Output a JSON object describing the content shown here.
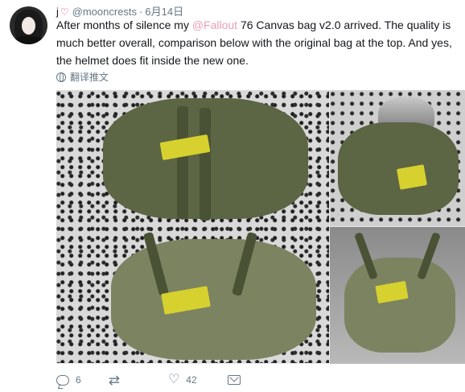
{
  "tweet": {
    "display_name": "j",
    "handle": "@mooncrests",
    "separator": "·",
    "time": "6月14日",
    "text_before": "After months of silence my ",
    "mention": "@Fallout",
    "text_after": " 76 Canvas bag v2.0 arrived. The quality is much better overall, comparison below with the original bag at the top. And yes, the helmet does fit inside the new one.",
    "translate_label": "翻译推文"
  },
  "actions": {
    "reply_count": "6",
    "retweet_count": "",
    "like_count": "42"
  },
  "icons": {
    "reply": "reply-icon",
    "retweet": "retweet-icon",
    "like": "like-icon",
    "dm": "direct-message-icon",
    "globe": "globe-icon",
    "heart": "heart-icon"
  },
  "colors": {
    "mention": "#e8a0b4",
    "heart": "#e0245e",
    "secondary_text": "#657786",
    "bag": "#5c6544",
    "label": "#d6d12e"
  }
}
